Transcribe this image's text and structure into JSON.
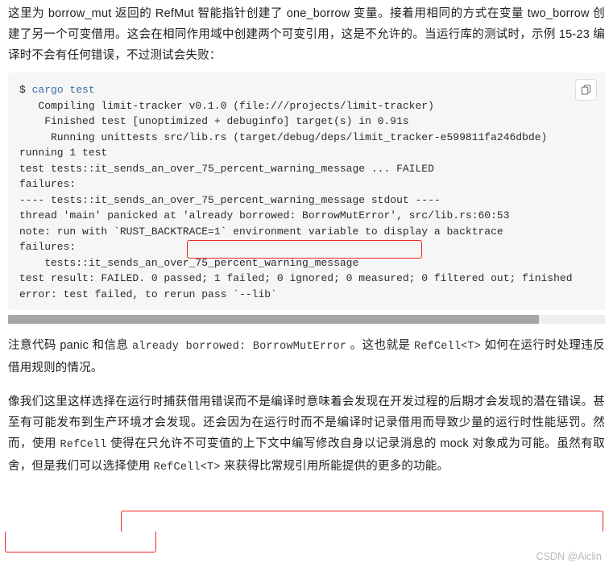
{
  "doc": {
    "paragraph_1": "这里为 borrow_mut 返回的 RefMut 智能指针创建了 one_borrow 变量。接着用相同的方式在变量 two_borrow 创建了另一个可变借用。这会在相同作用域中创建两个可变引用，这是不允许的。当运行库的测试时，示例 15-23 编译时不会有任何错误，不过测试会失败：",
    "code": {
      "prompt": "$",
      "command": "cargo test",
      "lines": [
        "   Compiling limit-tracker v0.1.0 (file:///projects/limit-tracker)",
        "    Finished test [unoptimized + debuginfo] target(s) in 0.91s",
        "     Running unittests src/lib.rs (target/debug/deps/limit_tracker-e599811fa246dbde)",
        "",
        "running 1 test",
        "test tests::it_sends_an_over_75_percent_warning_message ... FAILED",
        "",
        "failures:",
        "",
        "---- tests::it_sends_an_over_75_percent_warning_message stdout ----",
        "thread 'main' panicked at 'already borrowed: BorrowMutError', src/lib.rs:60:53",
        "note: run with `RUST_BACKTRACE=1` environment variable to display a backtrace",
        "",
        "",
        "failures:",
        "    tests::it_sends_an_over_75_percent_warning_message",
        "",
        "test result: FAILED. 0 passed; 1 failed; 0 ignored; 0 measured; 0 filtered out; finished",
        "",
        "error: test failed, to rerun pass `--lib`"
      ],
      "copy_button_label": "copy-icon"
    },
    "paragraph_2_parts": {
      "a": "注意代码 panic 和信息 ",
      "b": "already borrowed: BorrowMutError",
      "c": " 。这也就是 ",
      "d": "RefCell<T>",
      "e": " 如何在运行时处理违反借用规则的情况。"
    },
    "paragraph_3": "像我们这里这样选择在运行时捕获借用错误而不是编译时意味着会发现在开发过程的后期才会发现的潜在错误。甚至有可能发布到生产环境才会发现。还会因为在运行时而不是编译时记录借用而导致少量的运行时性能惩罚。然而，",
    "paragraph_4_parts": {
      "a": "使用 ",
      "b": "RefCell",
      "c": " 使得在只允许不可变值的上下文中编写修改自身以记录消息的 mock 对象成为可能。",
      "d": "虽然有取舍，",
      "e": "但是我们可以选择使用 ",
      "f": "RefCell<T>",
      "g": " 来获得比常规引用所能提供的更多的功能。"
    },
    "watermark": "CSDN @Aiclin"
  },
  "colors": {
    "annotation": "#e8271f",
    "code_bg": "#f6f6f6",
    "scrollbar_thumb": "#a6a6a6",
    "watermark": "#b9b9b9"
  }
}
